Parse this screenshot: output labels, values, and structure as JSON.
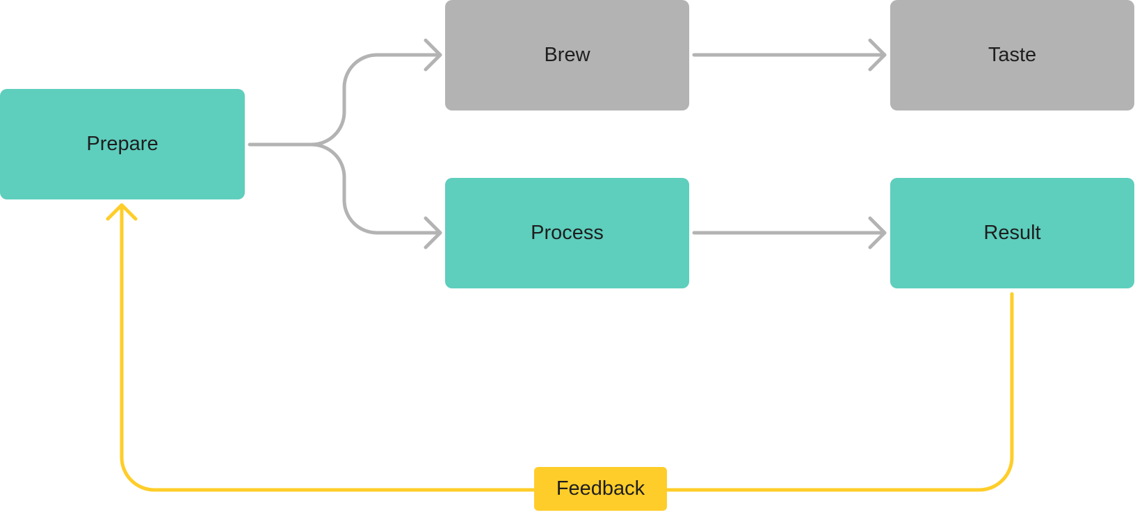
{
  "nodes": {
    "prepare": "Prepare",
    "brew": "Brew",
    "taste": "Taste",
    "process": "Process",
    "result": "Result"
  },
  "feedback_label": "Feedback",
  "colors": {
    "active": "#5ECEBD",
    "inactive": "#B3B3B3",
    "feedback": "#FFCD29",
    "connector": "#B3B3B3"
  }
}
